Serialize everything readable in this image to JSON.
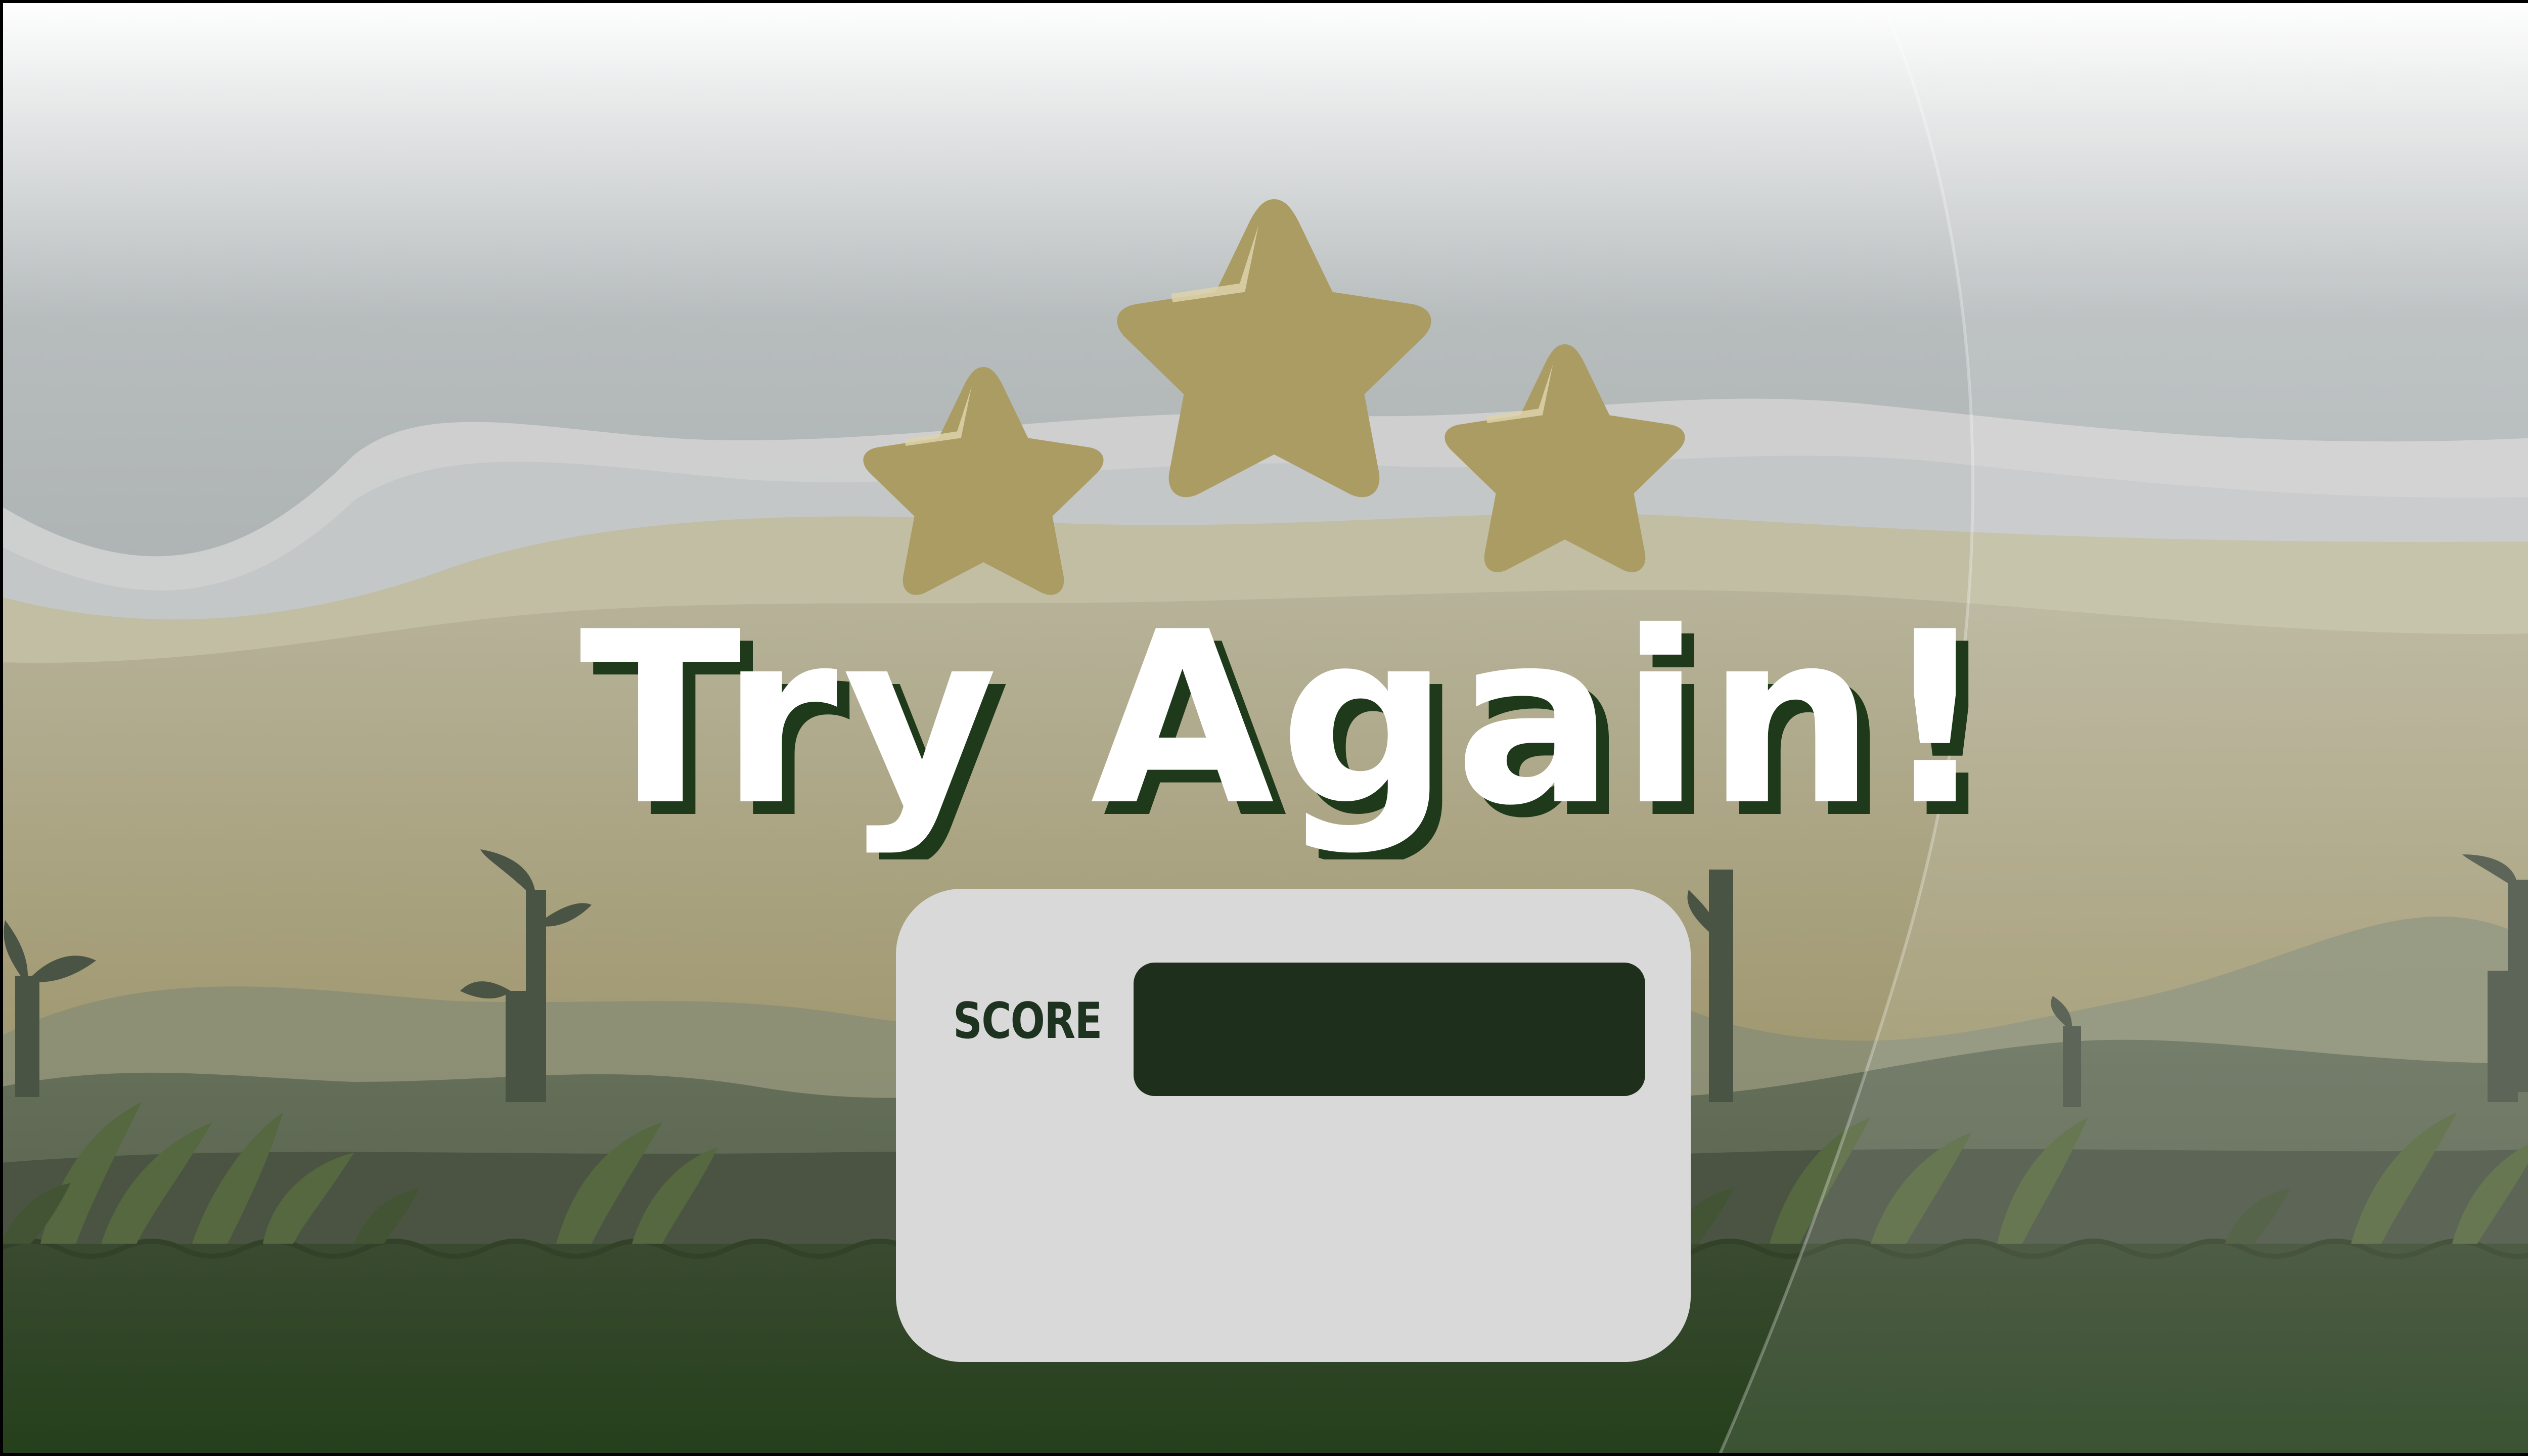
{
  "screen": "level_result",
  "result": {
    "title": "Try Again!",
    "stars_total": 3,
    "stars_earned": 0
  },
  "score_panel": {
    "label": "SCORE",
    "value": ""
  },
  "colors": {
    "star_fill": "#ab9c64",
    "star_highlight": "#ddd2aa",
    "title_fill": "#ffffff",
    "title_shadow": "#1e3a1a",
    "panel_bg": "#d9d9d9",
    "score_box": "#1e2f1b",
    "score_label": "#1d3320"
  },
  "icons": [
    "star-icon",
    "star-icon",
    "star-icon"
  ]
}
